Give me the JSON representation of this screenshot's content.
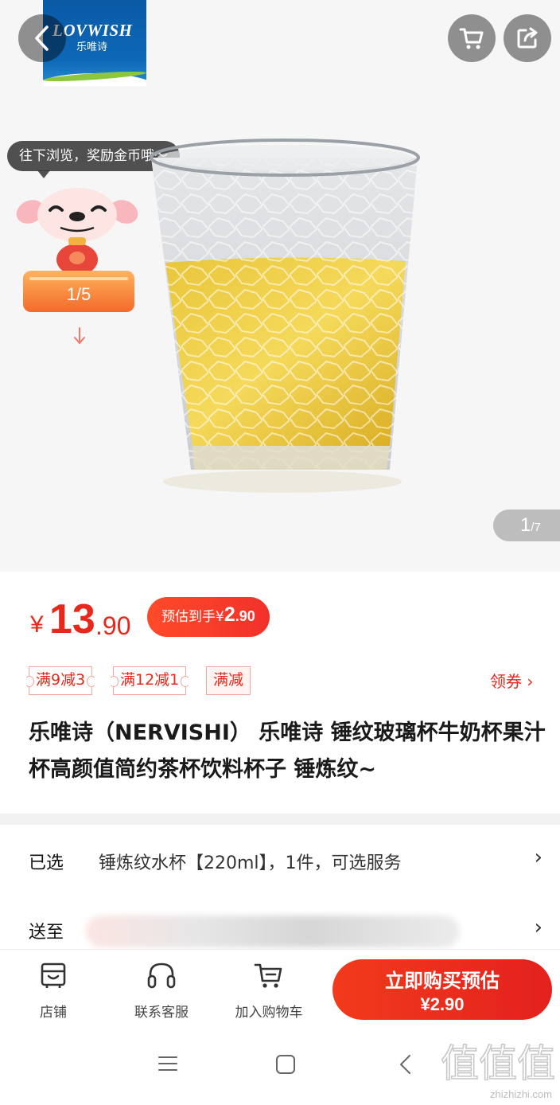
{
  "header": {
    "brand_logo_en": "LOVWISH",
    "brand_logo_cn": "乐唯诗",
    "back_icon": "chevron-left-icon",
    "cart_icon": "cart-icon",
    "share_icon": "share-icon"
  },
  "reward": {
    "bubble_text": "往下浏览，奖励金币哦～",
    "progress_text": "1/5"
  },
  "gallery": {
    "current": "1",
    "total": "/7"
  },
  "price": {
    "currency": "¥",
    "integer": "13",
    "decimal": ".90",
    "estimate_label": "预估到手",
    "estimate_currency": "¥",
    "estimate_integer": "2",
    "estimate_decimal": ".90"
  },
  "coupons": [
    {
      "label": "满9减3"
    },
    {
      "label": "满12减1"
    },
    {
      "label": "满减"
    }
  ],
  "get_coupon_label": "领券 ›",
  "product_title": "乐唯诗（NERVISHI） 乐唯诗 锤纹玻璃杯牛奶杯果汁杯高颜值简约茶杯饮料杯子 锤炼纹~",
  "selection": {
    "label": "已选",
    "value": "锤炼纹水杯【220ml】，1件，可选服务",
    "chevron": "›"
  },
  "shipping": {
    "label": "送至",
    "chevron": "›"
  },
  "action_bar": {
    "store_label": "店铺",
    "service_label": "联系客服",
    "add_cart_label": "加入购物车",
    "buy_label": "立即购买预估",
    "buy_price": "¥2.90"
  },
  "colors": {
    "accent": "#e8281b",
    "buy_button": "#e3211e",
    "reward_orange": "#f46a2a"
  },
  "watermark": {
    "text": "值值值",
    "url": "zhizhizhi.com"
  }
}
